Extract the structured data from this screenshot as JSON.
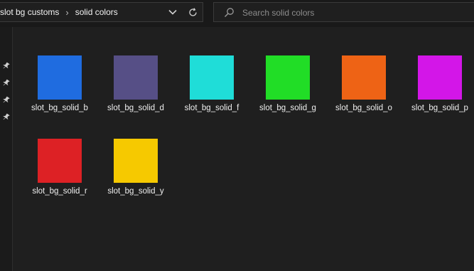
{
  "address_bar": {
    "breadcrumbs": [
      "slot bg customs",
      "solid colors"
    ],
    "separator": "›"
  },
  "search": {
    "placeholder": "Search solid colors"
  },
  "quick_access_pins": 4,
  "files": [
    {
      "name": "slot_bg_solid_b",
      "color": "#1f6ce0"
    },
    {
      "name": "slot_bg_solid_d",
      "color": "#564f86"
    },
    {
      "name": "slot_bg_solid_f",
      "color": "#1fddd8"
    },
    {
      "name": "slot_bg_solid_g",
      "color": "#21dd26"
    },
    {
      "name": "slot_bg_solid_o",
      "color": "#ee6315"
    },
    {
      "name": "slot_bg_solid_p",
      "color": "#d316e8"
    },
    {
      "name": "slot_bg_solid_r",
      "color": "#dd2125"
    },
    {
      "name": "slot_bg_solid_y",
      "color": "#f6c900"
    }
  ]
}
